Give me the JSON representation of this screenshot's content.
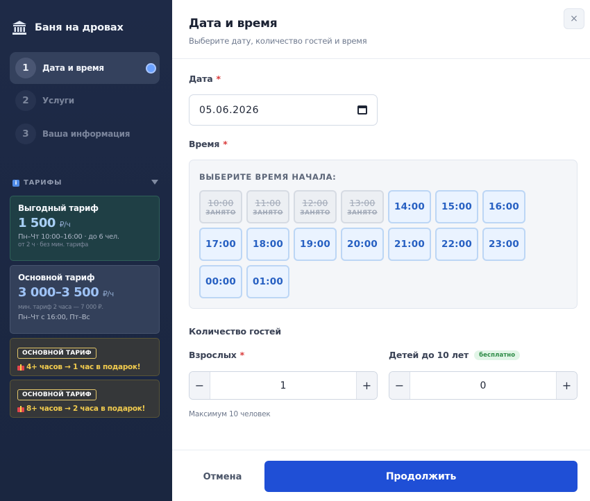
{
  "brand": {
    "name": "Баня на дровах",
    "icon": "bank-building-icon"
  },
  "steps": [
    {
      "num": "1",
      "label": "Дата и время",
      "active": true
    },
    {
      "num": "2",
      "label": "Услуги",
      "active": false
    },
    {
      "num": "3",
      "label": "Ваша информация",
      "active": false
    }
  ],
  "tariffs": {
    "title": "ТАРИФЫ",
    "cards": [
      {
        "title": "Выгодный тариф",
        "price": "1 500",
        "unit": "₽/ч",
        "line1": "Пн–Чт 10:00–16:00 · до 6 чел.",
        "line2": "от 2 ч · без мин. тарифа"
      },
      {
        "title": "Основной тариф",
        "price": "3 000–3 500",
        "unit": "₽/ч",
        "line1": "мин. тариф 2 часа — 7 000 ₽.",
        "line2": "Пн–Чт с 16:00, Пт–Вс"
      }
    ],
    "promos": [
      {
        "badge": "ОСНОВНОЙ ТАРИФ",
        "text": "4+ часов → 1 час в подарок!"
      },
      {
        "badge": "ОСНОВНОЙ ТАРИФ",
        "text": "8+ часов → 2 часа в подарок!"
      }
    ]
  },
  "main": {
    "title": "Дата и время",
    "subtitle": "Выберите дату, количество гостей и время",
    "close": "×"
  },
  "date": {
    "label": "Дата",
    "required": "*",
    "value": "05.06.2026"
  },
  "time": {
    "label": "Время",
    "required": "*",
    "caption": "ВЫБЕРИТЕ ВРЕМЯ НАЧАЛА:",
    "busy_note": "ЗАНЯТО",
    "slots": [
      {
        "time": "10:00",
        "busy": true
      },
      {
        "time": "11:00",
        "busy": true
      },
      {
        "time": "12:00",
        "busy": true
      },
      {
        "time": "13:00",
        "busy": true
      },
      {
        "time": "14:00",
        "busy": false
      },
      {
        "time": "15:00",
        "busy": false
      },
      {
        "time": "16:00",
        "busy": false
      },
      {
        "time": "17:00",
        "busy": false
      },
      {
        "time": "18:00",
        "busy": false
      },
      {
        "time": "19:00",
        "busy": false
      },
      {
        "time": "20:00",
        "busy": false
      },
      {
        "time": "21:00",
        "busy": false
      },
      {
        "time": "22:00",
        "busy": false
      },
      {
        "time": "23:00",
        "busy": false
      },
      {
        "time": "00:00",
        "busy": false
      },
      {
        "time": "01:00",
        "busy": false
      }
    ]
  },
  "guests": {
    "title": "Количество гостей",
    "adults": {
      "label": "Взрослых",
      "required": "*",
      "value": "1",
      "minus": "−",
      "plus": "+"
    },
    "children": {
      "label": "Детей до 10 лет",
      "badge": "бесплатно",
      "value": "0",
      "minus": "−",
      "plus": "+"
    },
    "max_note": "Максимум 10 человек"
  },
  "footer": {
    "cancel": "Отмена",
    "continue": "Продолжить"
  }
}
